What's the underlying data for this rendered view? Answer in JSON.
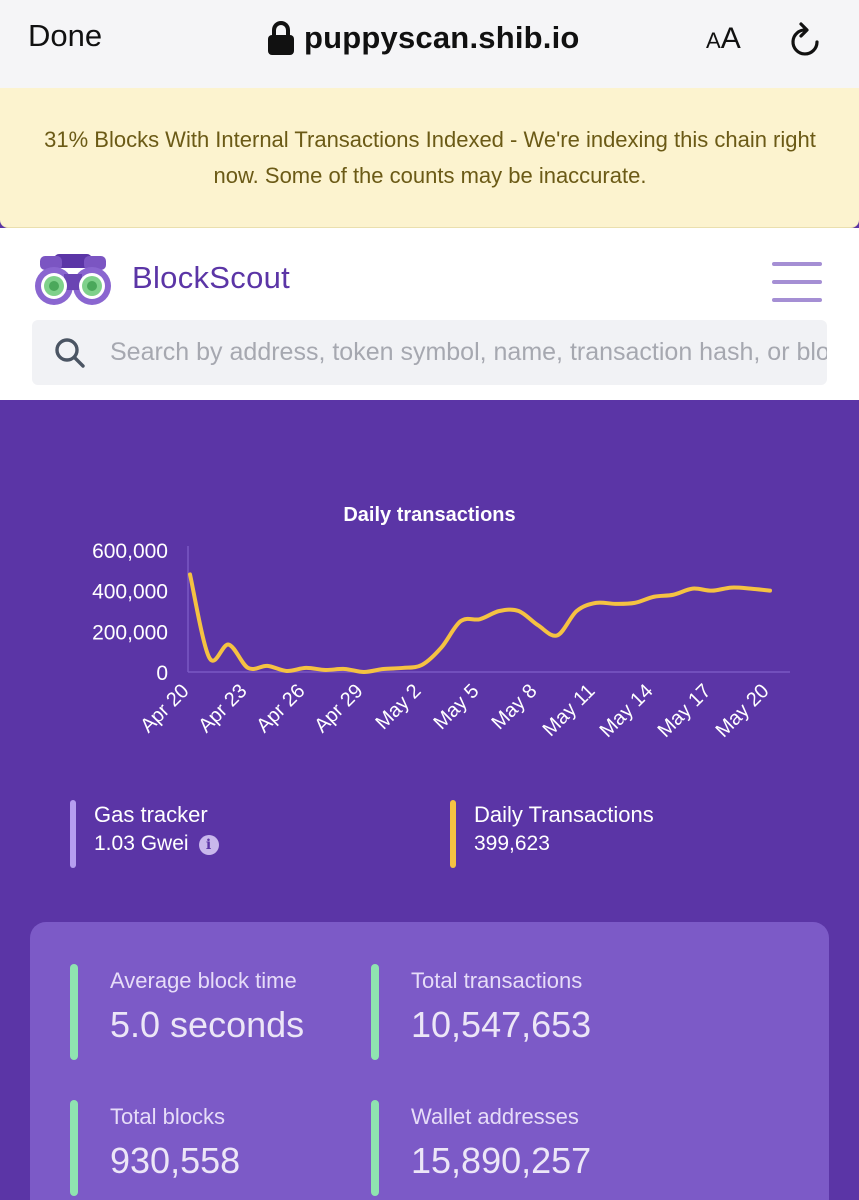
{
  "browser": {
    "done_label": "Done",
    "url": "puppyscan.shib.io",
    "aa_small": "A",
    "aa_big": "A",
    "icons": [
      "lock-icon",
      "reload-icon"
    ]
  },
  "banner": {
    "text": "31% Blocks With Internal Transactions Indexed - We're indexing this chain right now. Some of the counts may be inaccurate.",
    "background": "#fcf3cf",
    "text_color": "#6b5a16"
  },
  "header": {
    "logo_text": "BlockScout",
    "brand_color": "#5b35a6",
    "search_placeholder": "Search by address, token symbol, name, transaction hash, or block number"
  },
  "chart_data": {
    "type": "line",
    "title": "Daily transactions",
    "xlabel": "",
    "ylabel": "",
    "ylim": [
      0,
      600000
    ],
    "yticks": [
      0,
      200000,
      400000,
      600000
    ],
    "ytick_labels": [
      "0",
      "200,000",
      "400,000",
      "600,000"
    ],
    "xtick_labels": [
      "Apr 20",
      "Apr 23",
      "Apr 26",
      "Apr 29",
      "May 2",
      "May 5",
      "May 8",
      "May 11",
      "May 14",
      "May 17",
      "May 20"
    ],
    "x": [
      "Apr 20",
      "Apr 21",
      "Apr 22",
      "Apr 23",
      "Apr 24",
      "Apr 25",
      "Apr 26",
      "Apr 27",
      "Apr 28",
      "Apr 29",
      "Apr 30",
      "May 1",
      "May 2",
      "May 3",
      "May 4",
      "May 5",
      "May 6",
      "May 7",
      "May 8",
      "May 9",
      "May 10",
      "May 11",
      "May 12",
      "May 13",
      "May 14",
      "May 15",
      "May 16",
      "May 17",
      "May 18",
      "May 19",
      "May 20"
    ],
    "series": [
      {
        "color": "#f5c242",
        "values": [
          480000,
          70000,
          135000,
          20000,
          30000,
          5000,
          20000,
          10000,
          15000,
          0,
          15000,
          20000,
          35000,
          120000,
          250000,
          260000,
          300000,
          300000,
          230000,
          180000,
          300000,
          340000,
          335000,
          340000,
          370000,
          380000,
          410000,
          400000,
          415000,
          410000,
          400000
        ]
      }
    ],
    "grid": false,
    "legend": "none"
  },
  "gas_tracker": {
    "label": "Gas tracker",
    "value": "1.03 Gwei",
    "bar_color": "#b69ef0"
  },
  "daily_transactions": {
    "label": "Daily Transactions",
    "value": "399,623",
    "bar_color": "#f5c242"
  },
  "stats": {
    "average_block_time": {
      "label": "Average block time",
      "value": "5.0 seconds"
    },
    "total_transactions": {
      "label": "Total transactions",
      "value": "10,547,653"
    },
    "total_blocks": {
      "label": "Total blocks",
      "value": "930,558"
    },
    "wallet_addresses": {
      "label": "Wallet addresses",
      "value": "15,890,257"
    },
    "bar_color": "#8fe3b0"
  }
}
